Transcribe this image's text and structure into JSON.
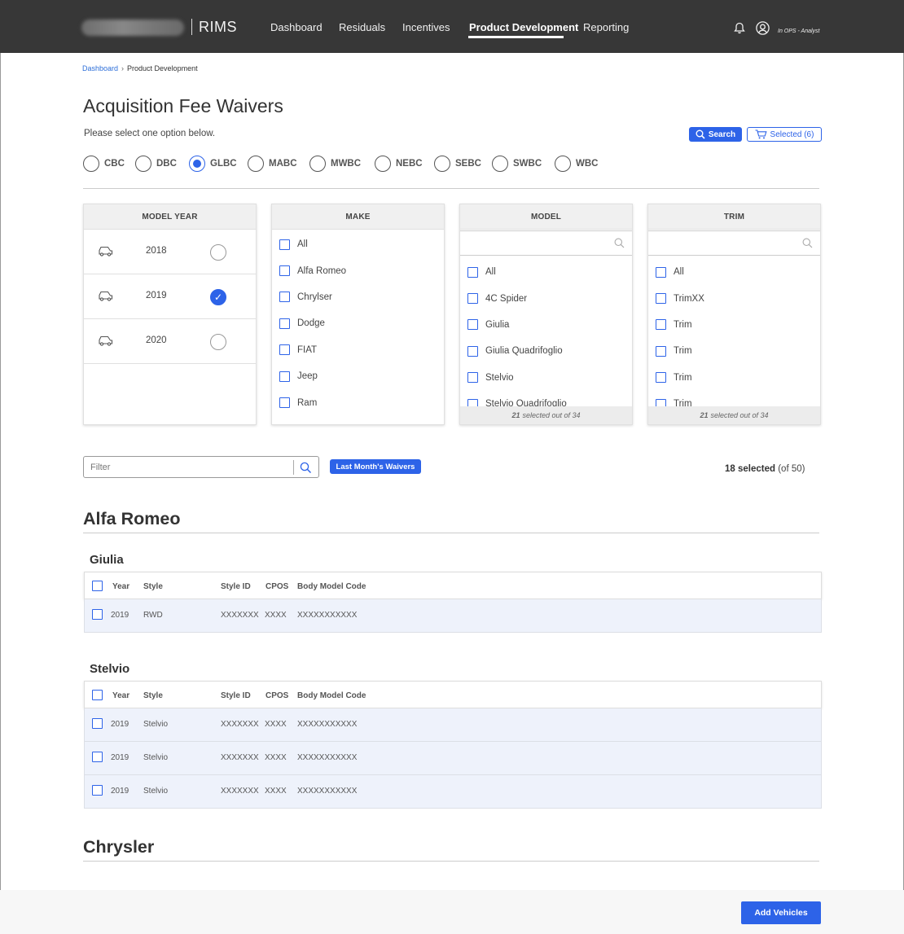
{
  "header": {
    "app_name": "RIMS",
    "nav": [
      "Dashboard",
      "Residuals",
      "Incentives",
      "Product Development",
      "Reporting"
    ],
    "active_nav": "Product Development",
    "user_label": "In OPS - Analyst"
  },
  "breadcrumb": {
    "home": "Dashboard",
    "current": "Product Development"
  },
  "page": {
    "title": "Acquisition Fee Waivers",
    "subtitle": "Please select one option below.",
    "search_label": "Search",
    "selected_label": "Selected (6)"
  },
  "regions": {
    "options": [
      "CBC",
      "DBC",
      "GLBC",
      "MABC",
      "MWBC",
      "NEBC",
      "SEBC",
      "SWBC",
      "WBC"
    ],
    "selected": "GLBC"
  },
  "panels": {
    "model_year": {
      "heading": "MODEL YEAR",
      "years": [
        {
          "year": "2018",
          "selected": false
        },
        {
          "year": "2019",
          "selected": true
        },
        {
          "year": "2020",
          "selected": false
        }
      ]
    },
    "make": {
      "heading": "MAKE",
      "items": [
        "All",
        "Alfa Romeo",
        "Chrylser",
        "Dodge",
        "FIAT",
        "Jeep",
        "Ram"
      ]
    },
    "model": {
      "heading": "MODEL",
      "items": [
        "All",
        "4C Spider",
        "Giulia",
        "Giulia Quadrifoglio",
        "Stelvio",
        "Stelvio Quadrifoglio"
      ],
      "footer_count": "21",
      "footer_text": "selected out of 34"
    },
    "trim": {
      "heading": "TRIM",
      "items": [
        "All",
        "TrimXX",
        "Trim",
        "Trim",
        "Trim",
        "Trim"
      ],
      "footer_count": "21",
      "footer_text": "selected out of 34"
    }
  },
  "filter": {
    "placeholder": "Filter",
    "last_month_label": "Last Month's Waivers",
    "selected_count": "18 selected",
    "selected_total": "(of 50)"
  },
  "table_columns": [
    "Year",
    "Style",
    "Style ID",
    "CPOS",
    "Body Model Code"
  ],
  "brands": [
    {
      "name": "Alfa Romeo",
      "models": [
        {
          "name": "Giulia",
          "rows": [
            [
              "2019",
              "RWD",
              "XXXXXXX",
              "XXXX",
              "XXXXXXXXXXX"
            ]
          ]
        },
        {
          "name": "Stelvio",
          "rows": [
            [
              "2019",
              "Stelvio",
              "XXXXXXX",
              "XXXX",
              "XXXXXXXXXXX"
            ],
            [
              "2019",
              "Stelvio",
              "XXXXXXX",
              "XXXX",
              "XXXXXXXXXXX"
            ],
            [
              "2019",
              "Stelvio",
              "XXXXXXX",
              "XXXX",
              "XXXXXXXXXXX"
            ]
          ]
        }
      ]
    },
    {
      "name": "Chrysler",
      "models": []
    }
  ],
  "footer": {
    "add_label": "Add Vehicles"
  },
  "colors": {
    "accent": "#2d63e8",
    "nav_bg": "#373737",
    "row_bg": "#eef2fb"
  }
}
